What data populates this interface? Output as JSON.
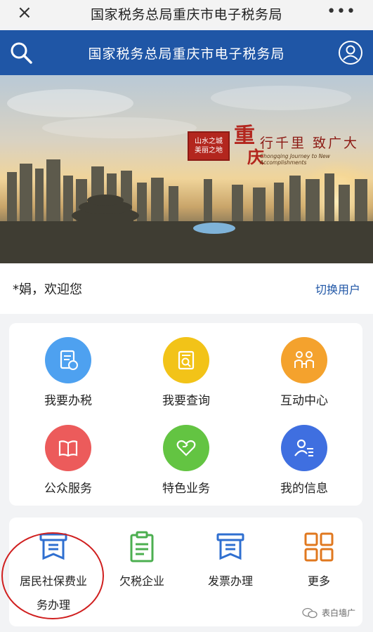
{
  "topbar": {
    "close_icon": "×",
    "title": "国家税务总局重庆市电子税务局",
    "more_icon": "•••"
  },
  "header": {
    "title": "国家税务总局重庆市电子税务局"
  },
  "banner": {
    "seal_line1": "山水之城",
    "seal_line2": "美丽之地",
    "city_char1": "重",
    "city_char2": "庆",
    "slogan": "行千里 致广大",
    "slogan_en": "Chongqing Journey to New Accomplishments"
  },
  "welcome": {
    "text": "*娟，欢迎您",
    "switch_label": "切换用户"
  },
  "main_grid": [
    {
      "label": "我要办税",
      "color": "#4ea1f0",
      "icon": "document-icon"
    },
    {
      "label": "我要查询",
      "color": "#f2c318",
      "icon": "search-doc-icon"
    },
    {
      "label": "互动中心",
      "color": "#f4a22d",
      "icon": "people-icon"
    },
    {
      "label": "公众服务",
      "color": "#ec5b5b",
      "icon": "book-icon"
    },
    {
      "label": "特色业务",
      "color": "#63c442",
      "icon": "heart-icon"
    },
    {
      "label": "我的信息",
      "color": "#3f6fe0",
      "icon": "user-info-icon"
    }
  ],
  "quick": [
    {
      "label": "居民社保费业",
      "label2": "务办理",
      "color": "#2f6fd0",
      "icon": "receipt-icon"
    },
    {
      "label": "欠税企业",
      "color": "#4caf50",
      "icon": "clipboard-icon"
    },
    {
      "label": "发票办理",
      "color": "#2f6fd0",
      "icon": "invoice-icon"
    },
    {
      "label": "更多",
      "color": "#e0781f",
      "icon": "grid-icon"
    }
  ],
  "watermark": {
    "text": "表白墙广"
  }
}
